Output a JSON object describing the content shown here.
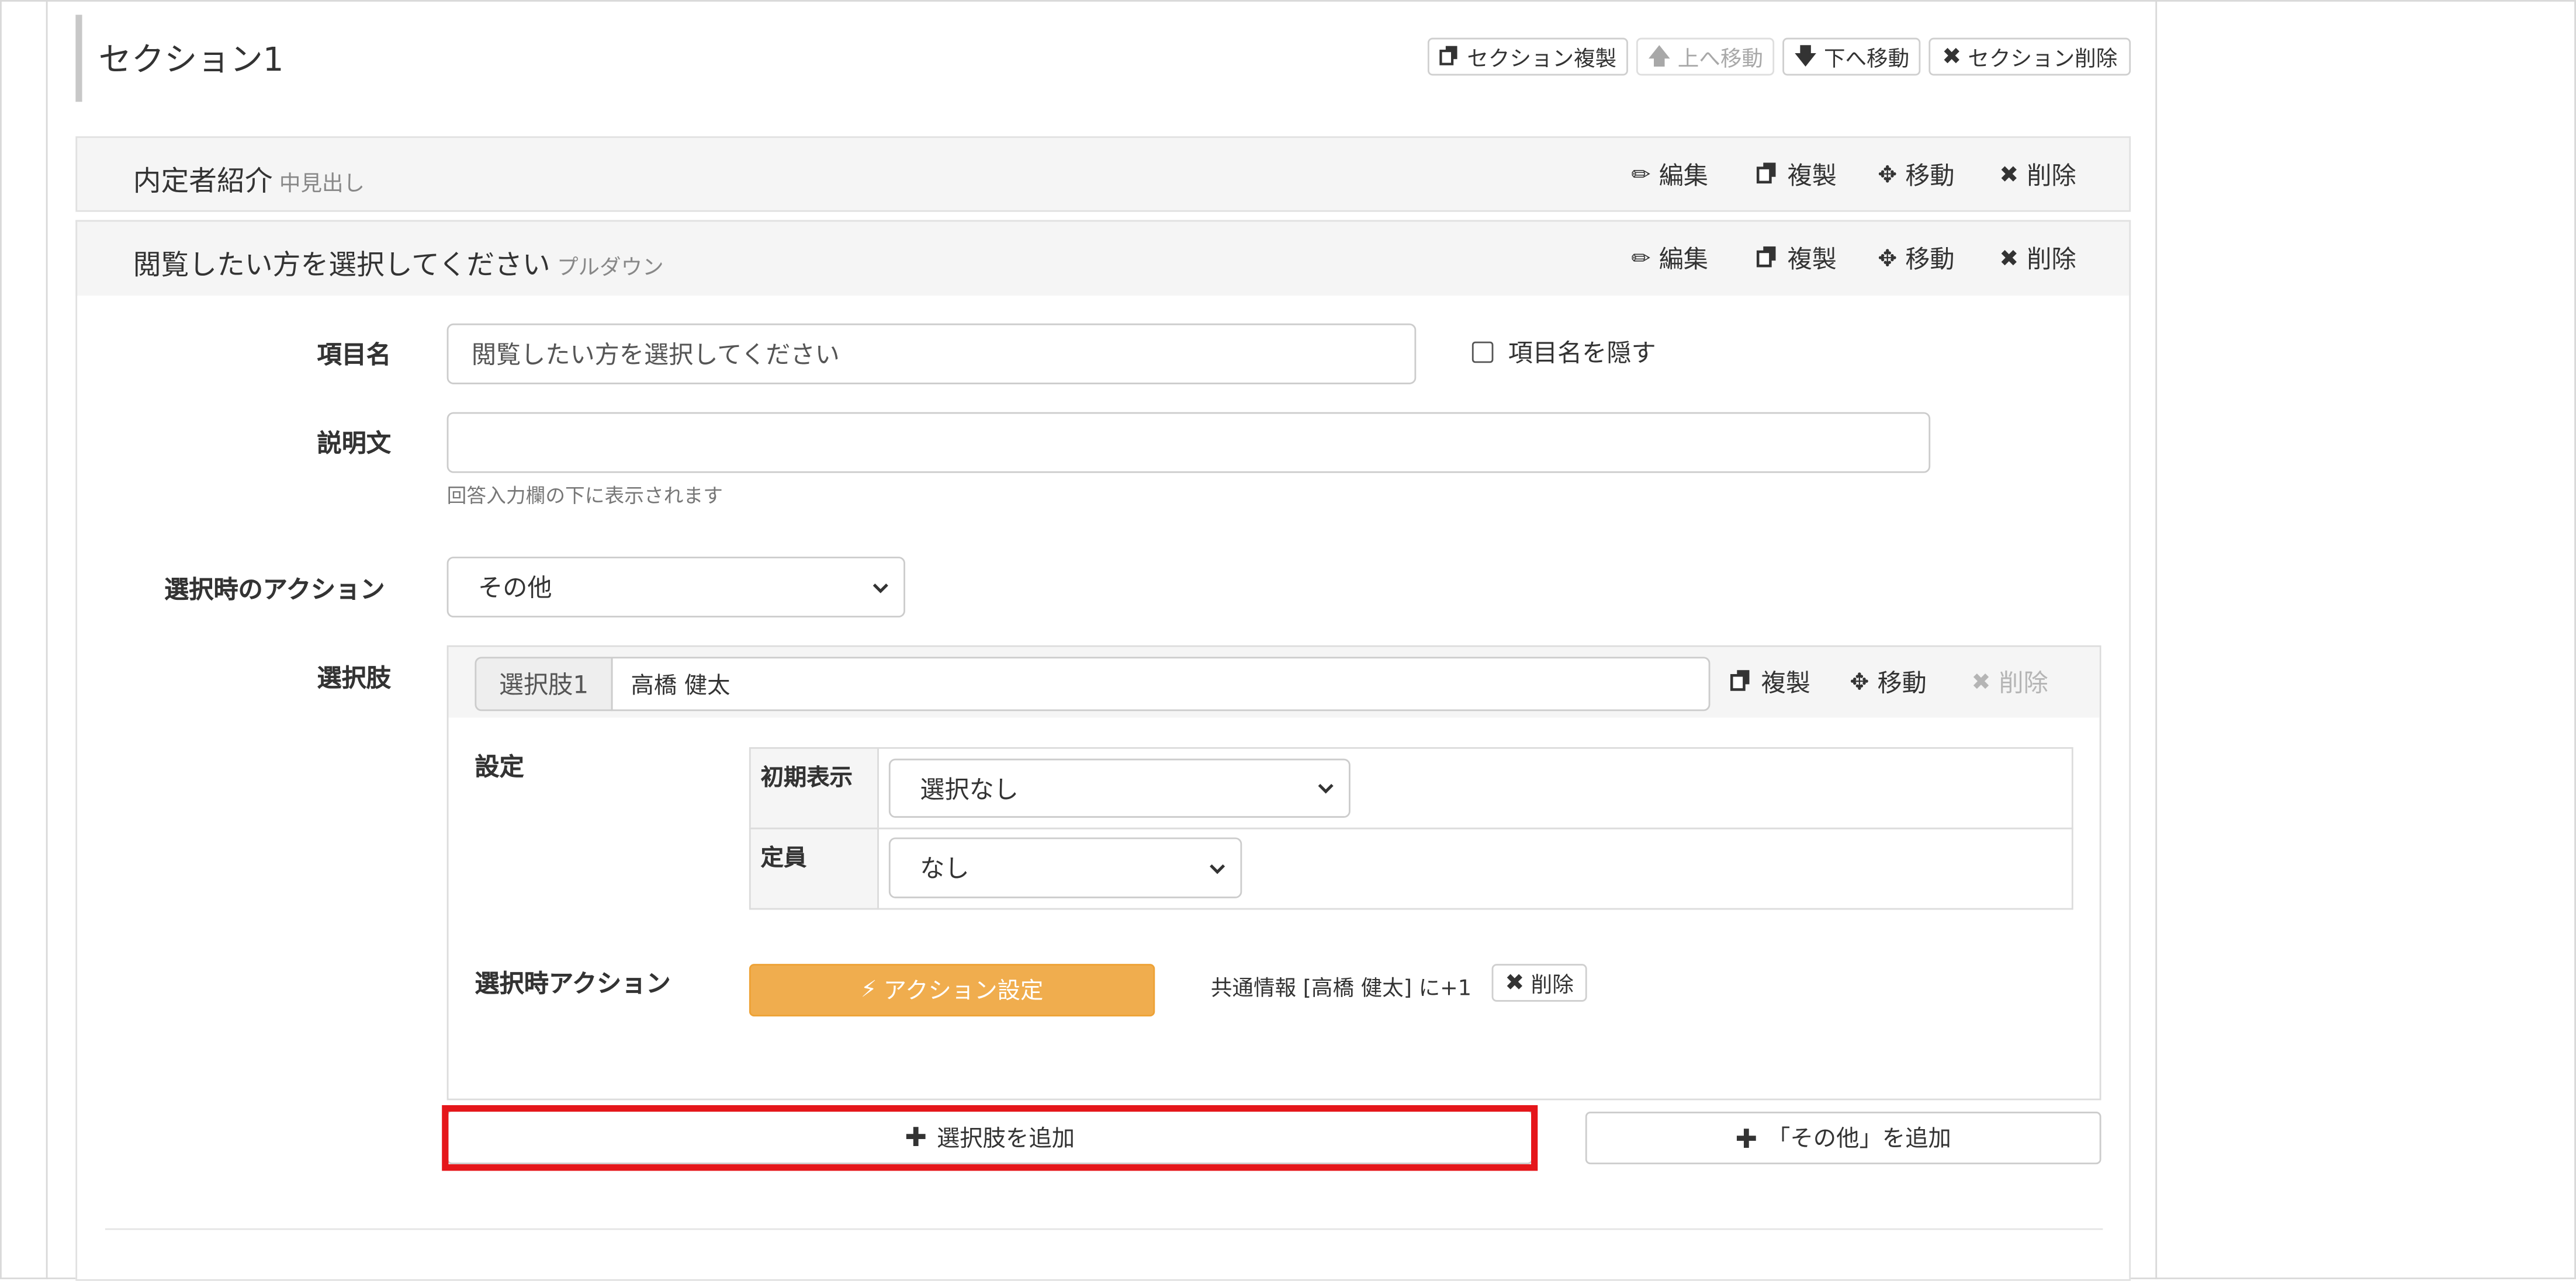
{
  "section": {
    "title": "セクション1",
    "buttons": {
      "duplicate": "セクション複製",
      "move_up": "上へ移動",
      "move_down": "下へ移動",
      "delete": "セクション削除"
    }
  },
  "items": [
    {
      "title": "内定者紹介",
      "type": "中見出し"
    },
    {
      "title": "閲覧したい方を選択してください",
      "type": "プルダウン"
    }
  ],
  "item_actions": {
    "edit": "編集",
    "duplicate": "複製",
    "move": "移動",
    "delete": "削除"
  },
  "form": {
    "item_name_label": "項目名",
    "item_name_value": "閲覧したい方を選択してください",
    "hide_label": "項目名を隠す",
    "description_label": "説明文",
    "description_value": "",
    "description_help": "回答入力欄の下に表示されます",
    "action_label": "選択時のアクション",
    "action_value": "その他",
    "choices_label": "選択肢"
  },
  "choice": {
    "prefix": "選択肢1",
    "value": "高橋 健太",
    "actions": {
      "duplicate": "複製",
      "move": "移動",
      "delete": "削除"
    },
    "settings_label": "設定",
    "initial_label": "初期表示",
    "initial_value": "選択なし",
    "capacity_label": "定員",
    "capacity_value": "なし",
    "action_section_label": "選択時アクション",
    "action_setting_button": "アクション設定",
    "action_summary": "共通情報 [高橋 健太] に+1",
    "action_delete": "削除"
  },
  "add_choice_button": "選択肢を追加",
  "add_other_button": "「その他」を追加",
  "colors": {
    "accent_orange": "#f0ad4e",
    "highlight_red": "#e5161a"
  },
  "icons": [
    "copy-icon",
    "arrow-up-icon",
    "arrow-down-icon",
    "close-icon",
    "pencil-icon",
    "move-icon",
    "lightning-icon",
    "plus-icon",
    "chevron-down-icon"
  ]
}
